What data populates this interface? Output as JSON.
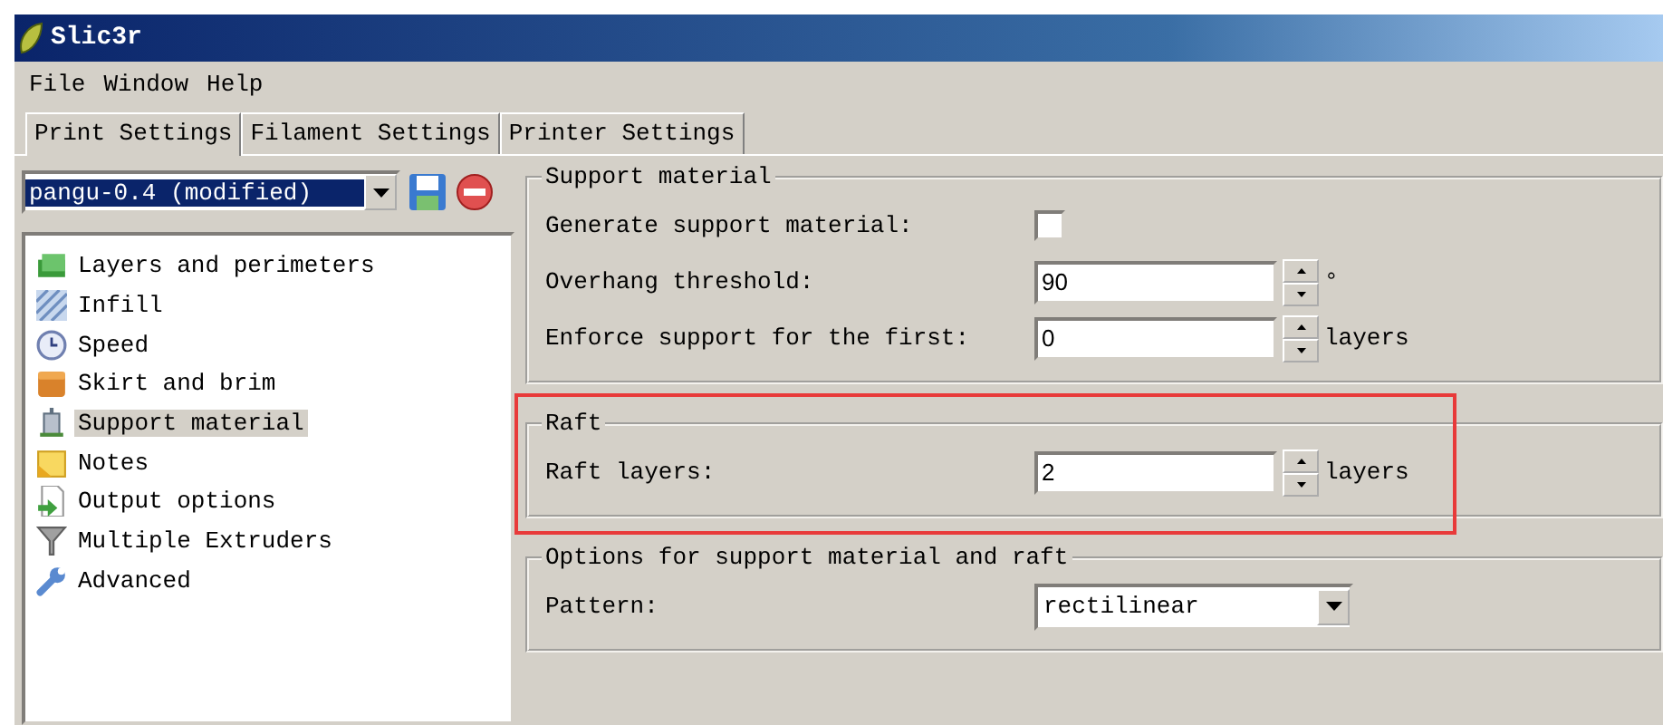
{
  "window": {
    "title": "Slic3r"
  },
  "menu": [
    "File",
    "Window",
    "Help"
  ],
  "tabs": [
    {
      "label": "Print Settings",
      "selected": true
    },
    {
      "label": "Filament Settings",
      "selected": false
    },
    {
      "label": "Printer Settings",
      "selected": false
    }
  ],
  "preset": {
    "value": "pangu-0.4 (modified)"
  },
  "sidebar": {
    "items": [
      {
        "label": "Layers and perimeters",
        "kind": "layers",
        "selected": false
      },
      {
        "label": "Infill",
        "kind": "infill",
        "selected": false
      },
      {
        "label": "Speed",
        "kind": "speed",
        "selected": false
      },
      {
        "label": "Skirt and brim",
        "kind": "skirt",
        "selected": false
      },
      {
        "label": "Support material",
        "kind": "support",
        "selected": true
      },
      {
        "label": "Notes",
        "kind": "notes",
        "selected": false
      },
      {
        "label": "Output options",
        "kind": "output",
        "selected": false
      },
      {
        "label": "Multiple Extruders",
        "kind": "extruders",
        "selected": false
      },
      {
        "label": "Advanced",
        "kind": "advanced",
        "selected": false
      }
    ]
  },
  "groups": [
    {
      "title": "Support material",
      "highlighted": false,
      "rows": [
        {
          "kind": "checkbox",
          "label": "Generate support material:",
          "checked": false
        },
        {
          "kind": "spin",
          "label": "Overhang threshold:",
          "value": "90",
          "unit": "°"
        },
        {
          "kind": "spin",
          "label": "Enforce support for the first:",
          "value": "0",
          "unit": "layers"
        }
      ]
    },
    {
      "title": "Raft",
      "highlighted": true,
      "rows": [
        {
          "kind": "spin",
          "label": "Raft layers:",
          "value": "2",
          "unit": "layers"
        }
      ]
    },
    {
      "title": "Options for support material and raft",
      "highlighted": false,
      "rows": [
        {
          "kind": "select",
          "label": "Pattern:",
          "value": "rectilinear"
        }
      ]
    }
  ]
}
